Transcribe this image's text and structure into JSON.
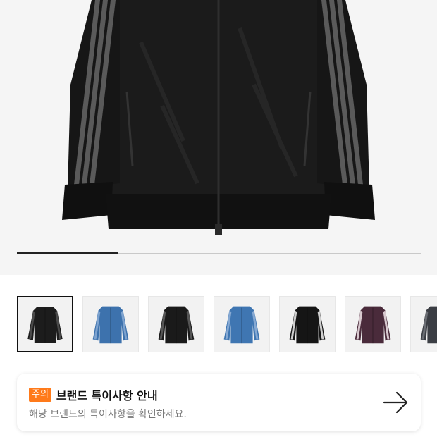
{
  "gallery": {
    "progress": 0.25,
    "main_image": "black-denim-track-jacket",
    "thumbnails": [
      {
        "name": "thumb-black-denim-jacket",
        "body": "#1c1c1c",
        "stripe": "#4a4a4a",
        "selected": true
      },
      {
        "name": "thumb-blue-jacket",
        "body": "#3d72ad",
        "stripe": "#7ea3cf",
        "selected": false
      },
      {
        "name": "thumb-black-jacket-2",
        "body": "#1a1a1a",
        "stripe": "#555555",
        "selected": false
      },
      {
        "name": "thumb-blue-jacket-2",
        "body": "#3f76b2",
        "stripe": "#86a9d3",
        "selected": false
      },
      {
        "name": "thumb-black-white-stripe-jacket",
        "body": "#151515",
        "stripe": "#cfcfcf",
        "selected": false
      },
      {
        "name": "thumb-purple-jacket",
        "body": "#4a2b3b",
        "stripe": "#d8c9cf",
        "selected": false
      },
      {
        "name": "thumb-grey-jacket",
        "body": "#3b3e44",
        "stripe": "#6b6e74",
        "selected": false
      }
    ]
  },
  "notice": {
    "badge": "주의",
    "title": "브랜드 특이사항 안내",
    "subtitle": "해당 브랜드의 특이사항을 확인하세요.",
    "badge_color": "#ff7a1a"
  },
  "icons": {
    "arrow": "arrow-right-icon"
  }
}
